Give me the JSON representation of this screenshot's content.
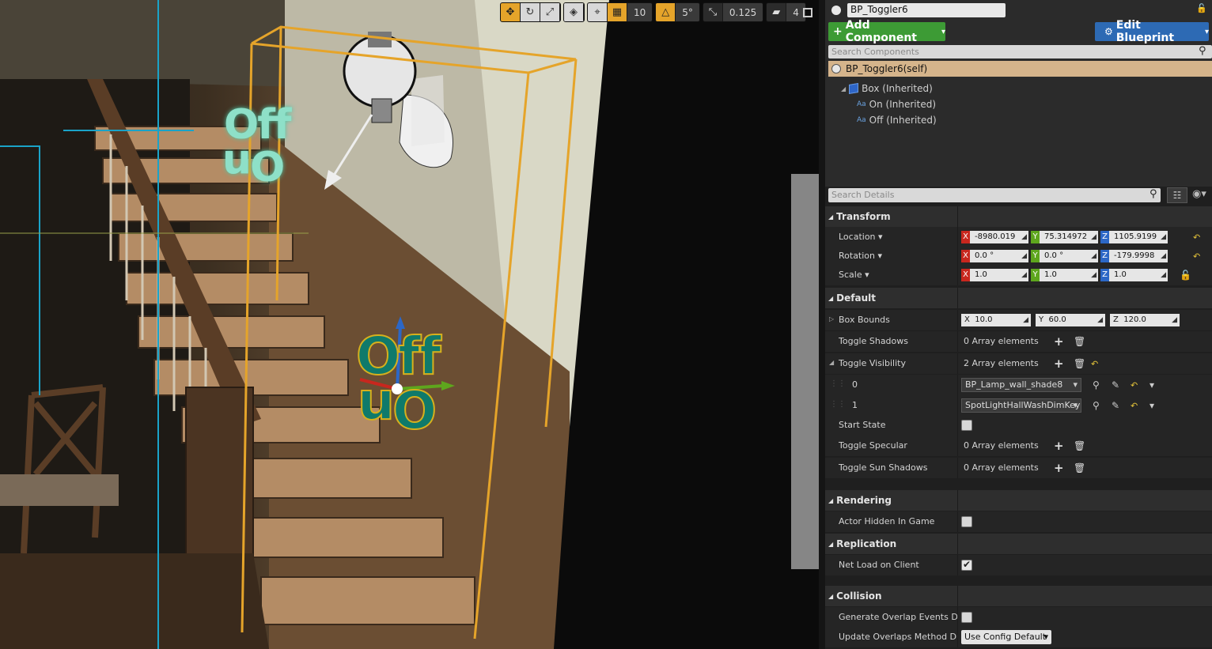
{
  "viewport": {
    "toolbar": {
      "grid_snap": "10",
      "rotation_snap": "5°",
      "scale_snap": "0.125",
      "camera_speed": "4"
    },
    "labels": {
      "off": "Off",
      "on": "On"
    }
  },
  "components": {
    "actor_name": "BP_Toggler6",
    "add_component": "Add Component",
    "edit_blueprint": "Edit Blueprint",
    "search_placeholder": "Search Components",
    "self_item": "BP_Toggler6(self)",
    "tree": [
      {
        "label": "Box (Inherited)",
        "icon": "cube-icon"
      },
      {
        "label": "On (Inherited)",
        "icon": "text-render-icon"
      },
      {
        "label": "Off (Inherited)",
        "icon": "text-render-icon"
      }
    ]
  },
  "details": {
    "search_placeholder": "Search Details",
    "sections": {
      "transform": "Transform",
      "default": "Default",
      "rendering": "Rendering",
      "replication": "Replication",
      "collision": "Collision"
    },
    "transform": {
      "location": {
        "label": "Location",
        "x": "-8980.019",
        "y": "75.314972",
        "z": "1105.9199"
      },
      "rotation": {
        "label": "Rotation",
        "x": "0.0 °",
        "y": "0.0 °",
        "z": "-179.9998"
      },
      "scale": {
        "label": "Scale",
        "x": "1.0",
        "y": "1.0",
        "z": "1.0"
      }
    },
    "default": {
      "box_bounds": {
        "label": "Box Bounds",
        "x": "10.0",
        "y": "60.0",
        "z": "120.0"
      },
      "toggle_shadows": {
        "label": "Toggle Shadows",
        "value": "0 Array elements"
      },
      "toggle_visibility": {
        "label": "Toggle Visibility",
        "value": "2 Array elements",
        "items": [
          {
            "index": "0",
            "value": "BP_Lamp_wall_shade8"
          },
          {
            "index": "1",
            "value": "SpotLightHallWashDimKey"
          }
        ]
      },
      "start_state": {
        "label": "Start State",
        "checked": false
      },
      "toggle_specular": {
        "label": "Toggle Specular",
        "value": "0 Array elements"
      },
      "toggle_sun_shadows": {
        "label": "Toggle Sun Shadows",
        "value": "0 Array elements"
      }
    },
    "rendering": {
      "actor_hidden": {
        "label": "Actor Hidden In Game",
        "checked": false
      }
    },
    "replication": {
      "net_load": {
        "label": "Net Load on Client",
        "checked": true
      }
    },
    "collision": {
      "generate_overlap": {
        "label": "Generate Overlap Events Durin",
        "checked": false
      },
      "update_overlaps": {
        "label": "Update Overlaps Method Durin",
        "value": "Use Config Default"
      }
    }
  },
  "colors": {
    "add_component": "#3d9b35",
    "edit_blueprint": "#2d6ab4",
    "selection_box": "#e5a42a",
    "self_row": "#d5b48b"
  }
}
